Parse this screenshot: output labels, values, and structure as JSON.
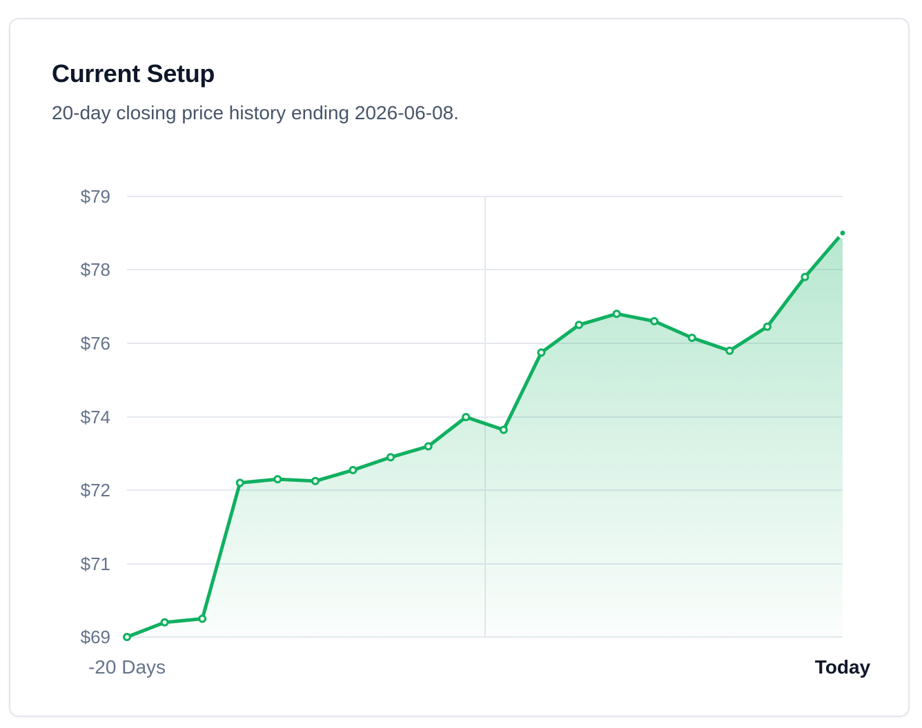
{
  "card": {
    "title": "Current Setup",
    "subtitle": "20-day closing price history ending 2026-06-08."
  },
  "colors": {
    "line": "#10b060",
    "grid": "#e5e9ef",
    "last_point_fill": "#ffffff"
  },
  "chart_data": {
    "type": "area",
    "title": "Current Setup",
    "subtitle": "20-day closing price history ending 2026-06-08.",
    "y_tick_labels": [
      "$79",
      "$78",
      "$76",
      "$74",
      "$72",
      "$71",
      "$69"
    ],
    "x_tick_labels": [
      "-20 Days",
      "Today"
    ],
    "grid": true,
    "series": [
      {
        "values": [
          69.0,
          69.4,
          69.5,
          72.2,
          72.3,
          72.25,
          72.55,
          72.9,
          73.2,
          74.0,
          73.65,
          75.75,
          76.5,
          76.8,
          76.6,
          76.15,
          75.8,
          76.45,
          77.8,
          78.5
        ]
      }
    ]
  }
}
